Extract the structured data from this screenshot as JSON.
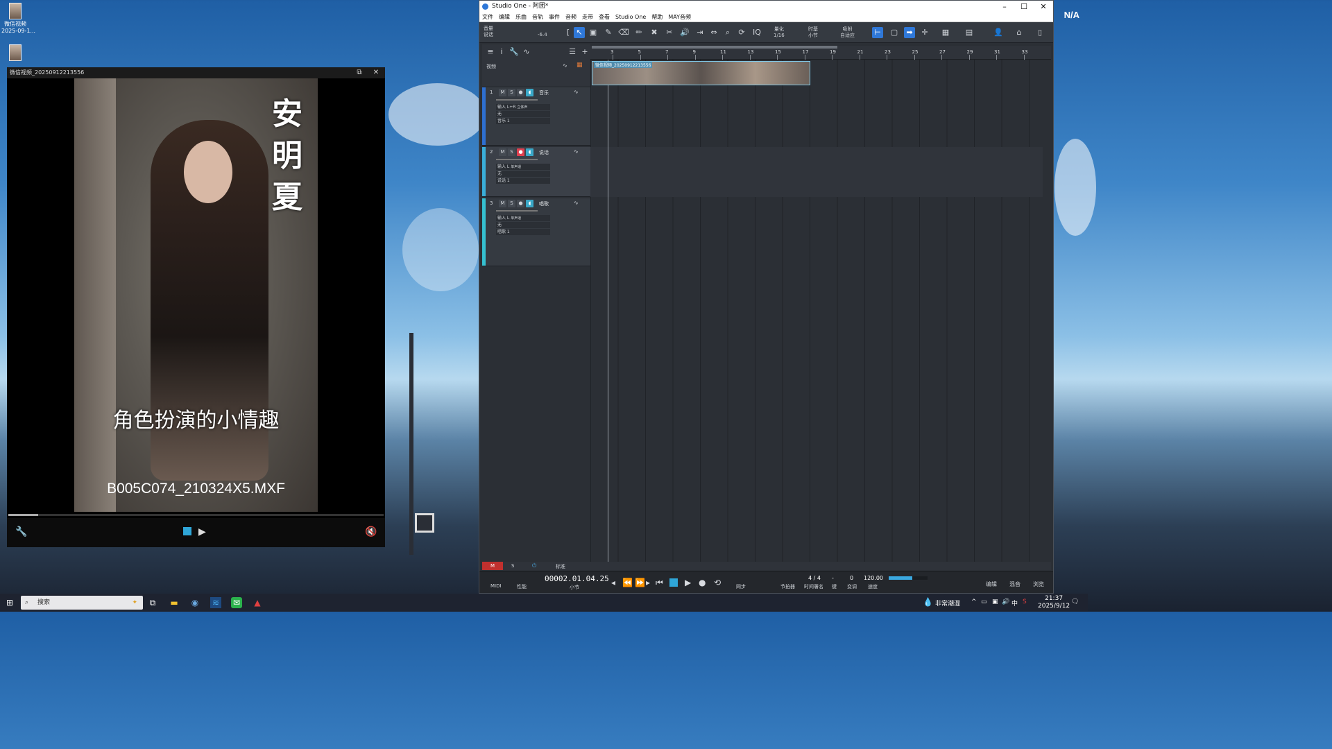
{
  "desktop": {
    "icons": [
      {
        "label": "微信视频\n2025-09-1..."
      },
      {
        "label": ""
      }
    ],
    "corner_text": "N/A"
  },
  "player": {
    "window_title": "微信视频_20250912213556",
    "video_title_vertical": "安明夏",
    "subtitle": "角色扮演的小情趣",
    "filename_overlay": "B005C074_210324X5.MXF",
    "progress_fraction": 0.08
  },
  "studio": {
    "window_title": "Studio One - 阿团*",
    "menu": [
      "文件",
      "编辑",
      "乐曲",
      "音轨",
      "事件",
      "音频",
      "走带",
      "查看",
      "Studio One",
      "帮助",
      "MAY音频"
    ],
    "toolbar": {
      "track_label": "音量",
      "track_sub": "说话",
      "db_value": "-6.4",
      "quantize_label": "量化",
      "quantize_value": "1/16",
      "timebase_label": "时基",
      "timebase_value": "小节",
      "snap_label": "吸附",
      "snap_value": "自适应"
    },
    "ruler_labels": [
      "3",
      "5",
      "7",
      "9",
      "11",
      "13",
      "15",
      "17",
      "19",
      "21",
      "23",
      "25",
      "27",
      "29",
      "31",
      "33"
    ],
    "video_track_label": "视频",
    "video_clip_title": "微信视频_20250912213556",
    "tracks": [
      {
        "num": "1",
        "name": "音乐",
        "input": "输入 L+R",
        "input_sub": "立体声",
        "sub": "无",
        "out": "音乐 1",
        "color": "#2e6fd0",
        "armed": false
      },
      {
        "num": "2",
        "name": "说话",
        "input": "输入 L",
        "input_sub": "单声道",
        "sub": "无",
        "out": "说话 1",
        "color": "#3aaed8",
        "armed": true
      },
      {
        "num": "3",
        "name": "唱歌",
        "input": "输入 L",
        "input_sub": "单声道",
        "sub": "无",
        "out": "唱歌 1",
        "color": "#35c0d0",
        "armed": false
      }
    ],
    "bottombar": {
      "m": "M",
      "s": "S",
      "mode": "标准"
    },
    "transport": {
      "midi": "MIDI",
      "perf": "性能",
      "position": "00002.01.04.25",
      "position_unit": "小节",
      "sync": "同步",
      "metronome": "节拍器",
      "signature": "4 / 4",
      "signature_label": "时间署名",
      "key": "-",
      "key_label": "键",
      "transpose": "0",
      "transpose_label": "变调",
      "tempo": "120.00",
      "tempo_label": "速度",
      "edit": "编辑",
      "mix": "混音",
      "browse": "浏览"
    }
  },
  "taskbar": {
    "search_placeholder": "搜索",
    "weather": "非常潮湿",
    "ime": "中",
    "time": "21:37",
    "date": "2025/9/12"
  }
}
